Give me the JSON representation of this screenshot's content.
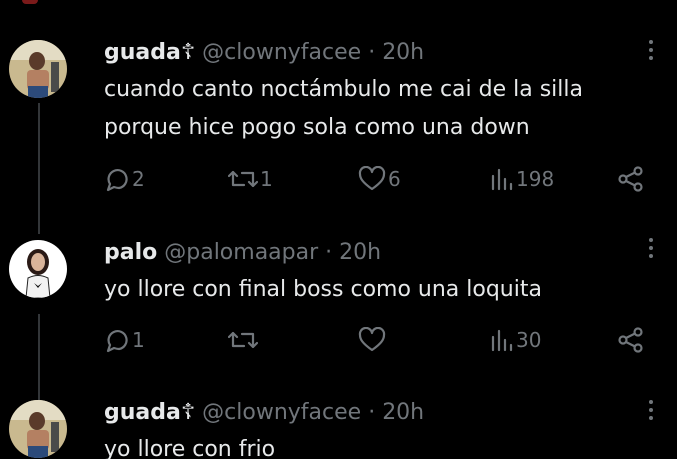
{
  "tweets": [
    {
      "display_name": "guada",
      "name_suffix": "☦",
      "handle": "@clownyfacee",
      "separator": "·",
      "time": "20h",
      "lines": [
        "cuando canto noctámbulo me cai de la silla",
        "porque hice pogo sola como una down"
      ],
      "replies": "2",
      "retweets": "1",
      "likes": "6",
      "views": "198"
    },
    {
      "display_name": "palo",
      "name_suffix": "",
      "handle": "@palomaapar",
      "separator": "·",
      "time": "20h",
      "lines": [
        "yo llore con final boss como una loquita"
      ],
      "replies": "1",
      "retweets": "",
      "likes": "",
      "views": "30"
    },
    {
      "display_name": "guada",
      "name_suffix": "☦",
      "handle": "@clownyfacee",
      "separator": "·",
      "time": "20h",
      "lines": [
        "yo llore con frio"
      ]
    }
  ],
  "icons": {
    "reply": "reply-icon",
    "retweet": "retweet-icon",
    "like": "heart-icon",
    "views": "views-icon",
    "share": "share-icon",
    "more": "more-icon"
  },
  "colors": {
    "background": "#000000",
    "text": "#e7e9ea",
    "muted": "#71767b",
    "thread_line": "#333639"
  }
}
